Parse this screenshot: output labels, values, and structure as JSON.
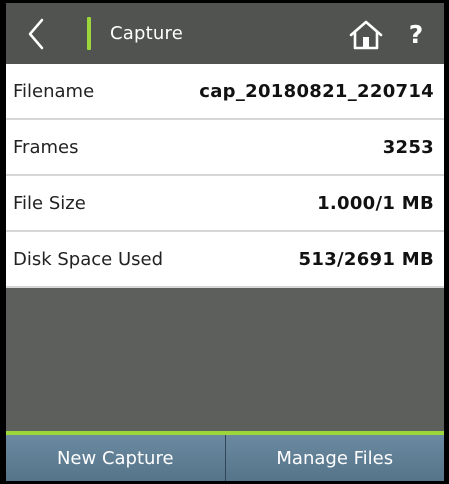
{
  "header": {
    "title": "Capture",
    "help_label": "?",
    "icons": {
      "back": "chevron-left-icon",
      "home": "home-icon"
    },
    "accent_color": "#9bd63b"
  },
  "rows": [
    {
      "label": "Filename",
      "value": "cap_20180821_220714"
    },
    {
      "label": "Frames",
      "value": "3253"
    },
    {
      "label": "File Size",
      "value": "1.000/1 MB"
    },
    {
      "label": "Disk Space Used",
      "value": "513/2691 MB"
    }
  ],
  "footer": {
    "new_capture_label": "New Capture",
    "manage_files_label": "Manage Files"
  }
}
